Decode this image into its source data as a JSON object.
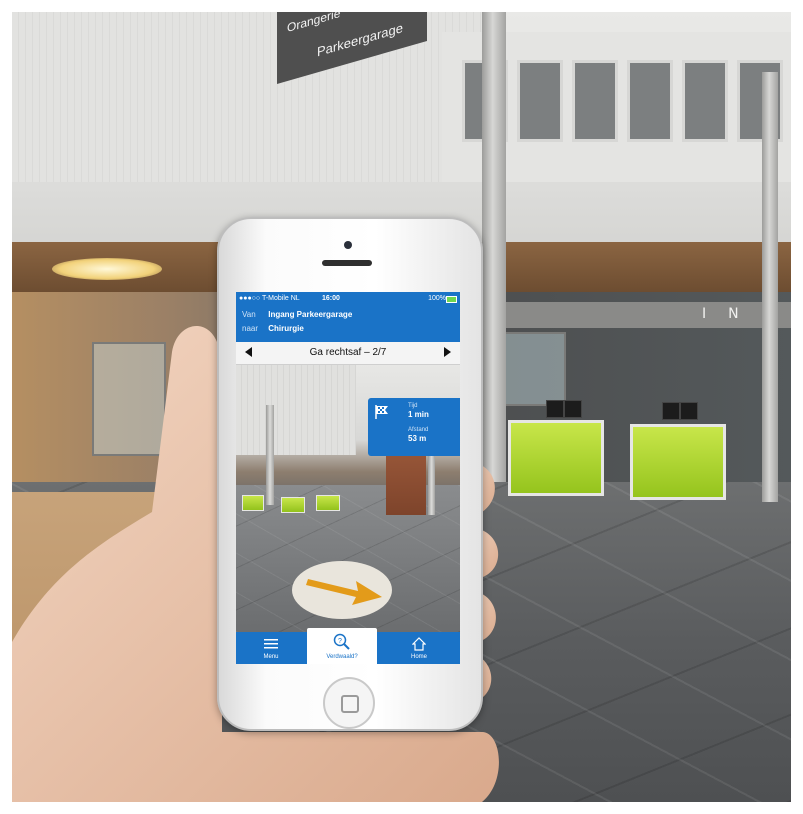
{
  "scene": {
    "sign": {
      "line1": "Orangerie",
      "line2": "Parkeergarage"
    },
    "info_wall": "INFO"
  },
  "phone": {
    "status_bar": {
      "carrier": "●●●○○ T-Mobile NL",
      "time": "16:00",
      "battery": "100%"
    },
    "route": {
      "from_label": "Van",
      "from_value": "Ingang Parkeergarage",
      "to_label": "naar",
      "to_value": "Chirurgie"
    },
    "step": {
      "title": "Ga rechtsaf – 2/7"
    },
    "info_card": {
      "time_label": "Tijd",
      "time_value": "1 min",
      "distance_label": "Afstand",
      "distance_value": "53 m"
    },
    "tabs": [
      {
        "label": "Menu",
        "icon": "menu-icon"
      },
      {
        "label": "Verdwaald?",
        "icon": "search-help-icon"
      },
      {
        "label": "Home",
        "icon": "home-icon"
      }
    ],
    "active_tab": "Verdwaald?",
    "colors": {
      "brand_blue": "#1a73c7",
      "arrow_orange": "#e39b1a",
      "desk_green": "#b5d92e"
    }
  }
}
